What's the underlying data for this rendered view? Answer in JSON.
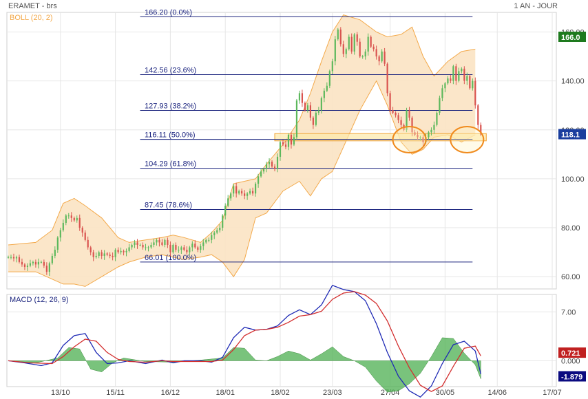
{
  "header": {
    "title": "ERAMET - brs",
    "period": "1 AN - JOUR"
  },
  "colors": {
    "up": "#5cb85c",
    "down": "#d9534f",
    "boll_fill": "#fbe3c3",
    "boll_line": "#f3a94a",
    "fib": "#1a237e",
    "macd": "#1f2ab5",
    "signal": "#d32f2f",
    "hist": "#4caf50",
    "zone_fill": "#fce8a8",
    "zone_stroke": "#f0a030",
    "ellipse": "#f08a1c",
    "badge_green": "#1e7a1e",
    "badge_blue": "#1a3e9e",
    "badge_red": "#c02020",
    "badge_navy": "#0a0a80"
  },
  "chart_data": [
    {
      "type": "candlestick",
      "name": "price",
      "indicator_label": "BOLL (20, 2)",
      "ylim": [
        55,
        168
      ],
      "yticks": [
        "160.00",
        "140.00",
        "120.00",
        "100.00",
        "80.00",
        "60.00"
      ],
      "ytick_values": [
        160,
        140,
        120,
        100,
        80,
        60
      ],
      "xticks": [
        "13/10",
        "15/11",
        "16/12",
        "18/01",
        "18/02",
        "23/03",
        "27/04",
        "30/05",
        "14/06",
        "17/07"
      ],
      "xtick_index": [
        19,
        39,
        59,
        79,
        99,
        118,
        139,
        159,
        178,
        198
      ],
      "total_slots": 200,
      "last_price_badge": "118.1",
      "max_badge": "166.0",
      "fib_levels": [
        {
          "label": "166.20  (0.0%)",
          "value": 166.2
        },
        {
          "label": "142.56  (23.6%)",
          "value": 142.56
        },
        {
          "label": "127.93  (38.2%)",
          "value": 127.93
        },
        {
          "label": "116.11  (50.0%)",
          "value": 116.11
        },
        {
          "label": "104.29  (61.8%)",
          "value": 104.29
        },
        {
          "label": "87.45  (78.6%)",
          "value": 87.45
        },
        {
          "label": "66.01  (100.0%)",
          "value": 66.01
        }
      ],
      "support_zone": {
        "from_index": 97,
        "to_index": 174,
        "low": 115.5,
        "high": 118.5
      },
      "highlight_points": [
        {
          "index": 146,
          "value": 116
        },
        {
          "index": 167,
          "value": 116
        }
      ],
      "close": [
        68,
        68,
        67.5,
        68,
        66,
        65,
        64,
        64.5,
        65.5,
        66,
        65,
        66,
        66,
        64.5,
        62,
        65.5,
        68.5,
        71,
        76,
        79,
        82,
        85,
        85,
        84,
        83,
        84,
        80,
        78,
        75,
        72,
        70,
        68,
        68.5,
        70,
        68.5,
        69.5,
        69,
        68.5,
        68,
        71,
        70,
        70.5,
        70,
        70.5,
        72,
        73,
        74,
        73,
        73,
        72,
        72,
        72,
        73,
        74,
        75,
        74,
        73,
        75,
        73,
        70,
        73,
        71,
        71,
        72,
        71,
        70,
        72,
        73.5,
        72,
        71,
        72.5,
        74,
        75,
        75,
        77,
        78,
        79,
        80,
        85,
        89,
        92,
        94,
        97,
        94,
        95,
        94,
        93,
        94,
        95,
        94,
        98,
        101,
        103,
        104,
        106,
        107,
        105,
        104,
        109,
        115,
        114,
        113,
        118,
        114,
        117,
        132,
        135,
        131,
        128,
        130,
        125,
        122,
        127,
        128,
        133,
        136,
        138,
        144,
        148,
        157,
        161,
        155,
        151,
        153,
        158,
        152,
        159,
        156,
        150,
        150,
        152,
        158,
        154,
        153,
        150,
        148,
        152,
        147,
        135,
        128,
        127,
        126,
        124,
        122,
        120,
        128,
        125,
        119,
        118,
        117,
        117,
        115,
        117,
        119,
        120,
        122,
        127,
        133,
        137,
        139,
        141,
        140,
        146,
        140,
        144,
        145,
        140,
        142,
        137,
        140,
        130,
        122,
        118
      ],
      "bollinger": [
        {
          "i": 0,
          "u": 73,
          "l": 62
        },
        {
          "i": 10,
          "u": 74,
          "l": 62
        },
        {
          "i": 16,
          "u": 79,
          "l": 59
        },
        {
          "i": 20,
          "u": 90,
          "l": 57
        },
        {
          "i": 24,
          "u": 92,
          "l": 57
        },
        {
          "i": 28,
          "u": 89,
          "l": 56
        },
        {
          "i": 34,
          "u": 84,
          "l": 60
        },
        {
          "i": 40,
          "u": 76,
          "l": 64
        },
        {
          "i": 44,
          "u": 74,
          "l": 66
        },
        {
          "i": 50,
          "u": 75,
          "l": 68
        },
        {
          "i": 56,
          "u": 76,
          "l": 69
        },
        {
          "i": 60,
          "u": 77,
          "l": 68
        },
        {
          "i": 64,
          "u": 76,
          "l": 67
        },
        {
          "i": 70,
          "u": 74,
          "l": 68
        },
        {
          "i": 74,
          "u": 78,
          "l": 69
        },
        {
          "i": 78,
          "u": 83,
          "l": 66
        },
        {
          "i": 82,
          "u": 98,
          "l": 60
        },
        {
          "i": 86,
          "u": 99,
          "l": 67
        },
        {
          "i": 90,
          "u": 100,
          "l": 84
        },
        {
          "i": 94,
          "u": 106,
          "l": 86
        },
        {
          "i": 100,
          "u": 114,
          "l": 95
        },
        {
          "i": 106,
          "u": 124,
          "l": 99
        },
        {
          "i": 110,
          "u": 135,
          "l": 93
        },
        {
          "i": 114,
          "u": 148,
          "l": 100
        },
        {
          "i": 118,
          "u": 160,
          "l": 103
        },
        {
          "i": 122,
          "u": 167,
          "l": 113
        },
        {
          "i": 128,
          "u": 165,
          "l": 128
        },
        {
          "i": 134,
          "u": 160,
          "l": 140
        },
        {
          "i": 138,
          "u": 158,
          "l": 130
        },
        {
          "i": 143,
          "u": 159,
          "l": 115
        },
        {
          "i": 147,
          "u": 162,
          "l": 110
        },
        {
          "i": 151,
          "u": 150,
          "l": 112
        },
        {
          "i": 155,
          "u": 142,
          "l": 117
        },
        {
          "i": 160,
          "u": 148,
          "l": 118
        },
        {
          "i": 165,
          "u": 152,
          "l": 115
        },
        {
          "i": 170,
          "u": 153,
          "l": 118
        }
      ]
    },
    {
      "type": "line",
      "name": "macd_panel",
      "indicator_label": "MACD (12, 26, 9)",
      "ylim": [
        -3.7,
        9.5
      ],
      "yticks": [
        "7.00",
        "0.000"
      ],
      "ytick_values": [
        7,
        0
      ],
      "badges": [
        "0.721",
        "-1.879"
      ],
      "series": [
        {
          "name": "MACD",
          "points": [
            [
              0,
              0
            ],
            [
              6,
              -0.3
            ],
            [
              12,
              -0.7
            ],
            [
              16,
              -0.3
            ],
            [
              20,
              2.2
            ],
            [
              24,
              3.6
            ],
            [
              28,
              3.9
            ],
            [
              32,
              1.2
            ],
            [
              36,
              -0.4
            ],
            [
              40,
              -0.3
            ],
            [
              44,
              0
            ],
            [
              50,
              -0.4
            ],
            [
              56,
              0.1
            ],
            [
              60,
              -0.3
            ],
            [
              64,
              0
            ],
            [
              70,
              0
            ],
            [
              74,
              -0.2
            ],
            [
              78,
              0.5
            ],
            [
              82,
              3.3
            ],
            [
              86,
              4.8
            ],
            [
              90,
              4.4
            ],
            [
              94,
              4.5
            ],
            [
              98,
              5
            ],
            [
              102,
              6.5
            ],
            [
              106,
              7.3
            ],
            [
              110,
              6.6
            ],
            [
              114,
              8
            ],
            [
              118,
              10.8
            ],
            [
              122,
              10.2
            ],
            [
              126,
              9.9
            ],
            [
              130,
              8.6
            ],
            [
              134,
              5.3
            ],
            [
              138,
              1.2
            ],
            [
              142,
              -2.2
            ],
            [
              146,
              -4.3
            ],
            [
              150,
              -5.2
            ],
            [
              154,
              -3.6
            ],
            [
              158,
              -0.4
            ],
            [
              162,
              2.3
            ],
            [
              166,
              2.8
            ],
            [
              170,
              1.4
            ],
            [
              172,
              -1.9
            ]
          ]
        },
        {
          "name": "Signal",
          "points": [
            [
              0,
              0
            ],
            [
              8,
              -0.3
            ],
            [
              16,
              -0.4
            ],
            [
              20,
              0.6
            ],
            [
              24,
              2
            ],
            [
              28,
              3.1
            ],
            [
              32,
              2.8
            ],
            [
              36,
              1.2
            ],
            [
              40,
              0.2
            ],
            [
              44,
              -0.1
            ],
            [
              50,
              -0.2
            ],
            [
              56,
              0
            ],
            [
              60,
              -0.1
            ],
            [
              64,
              -0.1
            ],
            [
              70,
              -0.1
            ],
            [
              74,
              -0.1
            ],
            [
              78,
              0.1
            ],
            [
              82,
              1.6
            ],
            [
              86,
              3.6
            ],
            [
              90,
              4.4
            ],
            [
              94,
              4.5
            ],
            [
              98,
              4.8
            ],
            [
              102,
              5.5
            ],
            [
              106,
              6.4
            ],
            [
              110,
              6.6
            ],
            [
              114,
              7.1
            ],
            [
              118,
              8.8
            ],
            [
              122,
              9.7
            ],
            [
              126,
              9.9
            ],
            [
              130,
              9.4
            ],
            [
              134,
              8.2
            ],
            [
              138,
              5.7
            ],
            [
              142,
              2.1
            ],
            [
              146,
              -1
            ],
            [
              150,
              -3.5
            ],
            [
              154,
              -4.4
            ],
            [
              158,
              -3.6
            ],
            [
              162,
              -0.8
            ],
            [
              166,
              1.8
            ],
            [
              170,
              2.1
            ],
            [
              172,
              0.7
            ]
          ]
        }
      ],
      "histogram": [
        [
          0,
          0
        ],
        [
          10,
          -0.3
        ],
        [
          18,
          0.4
        ],
        [
          22,
          1.9
        ],
        [
          26,
          1.7
        ],
        [
          30,
          -1.2
        ],
        [
          34,
          -1.6
        ],
        [
          38,
          -0.3
        ],
        [
          42,
          0.4
        ],
        [
          50,
          -0.1
        ],
        [
          60,
          -0.2
        ],
        [
          70,
          0.1
        ],
        [
          78,
          0.4
        ],
        [
          82,
          1.9
        ],
        [
          86,
          1.8
        ],
        [
          90,
          0.1
        ],
        [
          94,
          0
        ],
        [
          98,
          0.6
        ],
        [
          102,
          1.4
        ],
        [
          106,
          1
        ],
        [
          110,
          0.1
        ],
        [
          114,
          1
        ],
        [
          118,
          2
        ],
        [
          122,
          0.6
        ],
        [
          126,
          0
        ],
        [
          130,
          -0.9
        ],
        [
          134,
          -2.9
        ],
        [
          138,
          -4.5
        ],
        [
          142,
          -4.3
        ],
        [
          146,
          -3.3
        ],
        [
          150,
          -1.8
        ],
        [
          154,
          0.6
        ],
        [
          158,
          3.3
        ],
        [
          162,
          3.2
        ],
        [
          166,
          1.1
        ],
        [
          170,
          -0.6
        ],
        [
          172,
          -2.6
        ]
      ]
    }
  ]
}
